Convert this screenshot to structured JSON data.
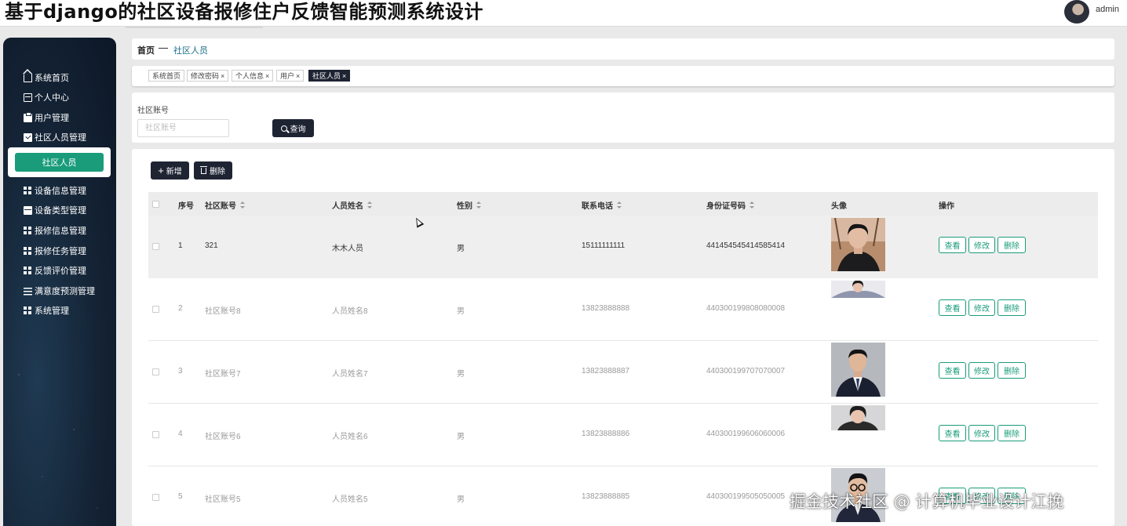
{
  "header": {
    "title": "基于django的社区设备报修住户反馈智能预测系统设计",
    "username": "admin"
  },
  "sidebar": {
    "items": [
      {
        "label": "系统首页",
        "icon": "home-icon"
      },
      {
        "label": "个人中心",
        "icon": "id-card-icon"
      },
      {
        "label": "用户管理",
        "icon": "clipboard-icon"
      },
      {
        "label": "社区人员管理",
        "icon": "checkbox-icon"
      },
      {
        "label": "设备信息管理",
        "icon": "grid-icon"
      },
      {
        "label": "设备类型管理",
        "icon": "box-icon"
      },
      {
        "label": "报修信息管理",
        "icon": "grid-icon"
      },
      {
        "label": "报修任务管理",
        "icon": "grid-icon"
      },
      {
        "label": "反馈评价管理",
        "icon": "grid-icon"
      },
      {
        "label": "满意度预测管理",
        "icon": "list-icon"
      },
      {
        "label": "系统管理",
        "icon": "grid-icon"
      }
    ],
    "active_sub_item": "社区人员"
  },
  "breadcrumb": {
    "home": "首页",
    "current": "社区人员"
  },
  "tabs": [
    {
      "label": "系统首页",
      "closable": false,
      "active": false
    },
    {
      "label": "修改密码",
      "closable": true,
      "active": false
    },
    {
      "label": "个人信息",
      "closable": true,
      "active": false
    },
    {
      "label": "用户",
      "closable": true,
      "active": false
    },
    {
      "label": "社区人员",
      "closable": true,
      "active": true
    }
  ],
  "search": {
    "label": "社区账号",
    "placeholder": "社区账号",
    "button_label": "查询"
  },
  "actions": {
    "add_label": "新增",
    "delete_label": "删除"
  },
  "table": {
    "columns": [
      "序号",
      "社区账号",
      "人员姓名",
      "性别",
      "联系电话",
      "身份证号码",
      "头像",
      "操作"
    ],
    "operations": [
      "查看",
      "修改",
      "删除"
    ],
    "rows": [
      {
        "index": "1",
        "account": "321",
        "name": "木木人员",
        "gender": "男",
        "phone": "15111111111",
        "id_number": "441454545414585414",
        "avatar": "photo-man-coat"
      },
      {
        "index": "2",
        "account": "社区账号8",
        "name": "人员姓名8",
        "gender": "男",
        "phone": "13823888888",
        "id_number": "440300199808080008",
        "avatar": "photo-woman-partial"
      },
      {
        "index": "3",
        "account": "社区账号7",
        "name": "人员姓名7",
        "gender": "男",
        "phone": "13823888887",
        "id_number": "440300199707070007",
        "avatar": "photo-man-suit"
      },
      {
        "index": "4",
        "account": "社区账号6",
        "name": "人员姓名6",
        "gender": "男",
        "phone": "13823888886",
        "id_number": "440300199606060006",
        "avatar": "photo-woman-partial"
      },
      {
        "index": "5",
        "account": "社区账号5",
        "name": "人员姓名5",
        "gender": "男",
        "phone": "13823888885",
        "id_number": "440300199505050005",
        "avatar": "photo-man-glasses"
      }
    ]
  },
  "watermark": "掘金技术社区 @ 计算机毕业设计江挽",
  "colors": {
    "accent": "#1a9c7a",
    "dark_button": "#1f2433",
    "sidebar_bg": "#142335"
  }
}
